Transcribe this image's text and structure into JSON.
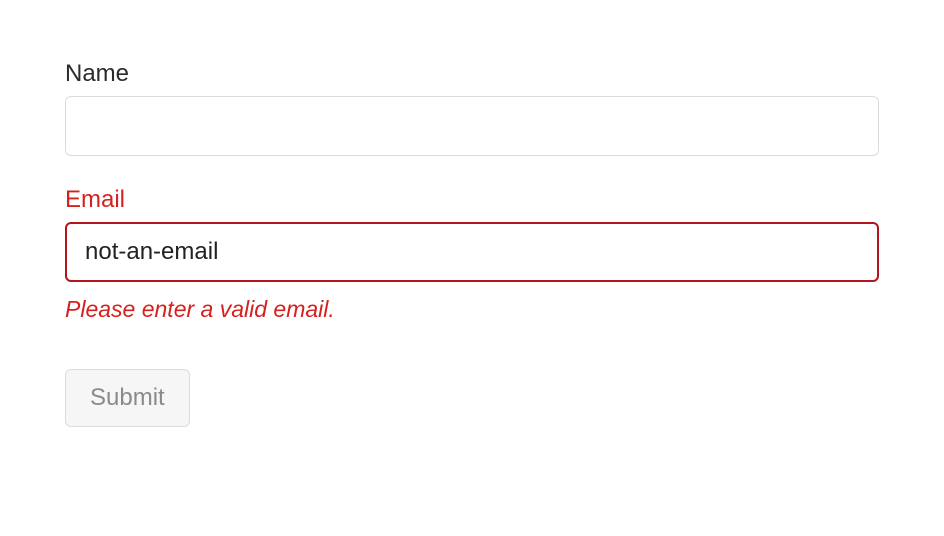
{
  "form": {
    "name": {
      "label": "Name",
      "value": ""
    },
    "email": {
      "label": "Email",
      "value": "not-an-email",
      "error_message": "Please enter a valid email."
    },
    "submit_label": "Submit"
  }
}
